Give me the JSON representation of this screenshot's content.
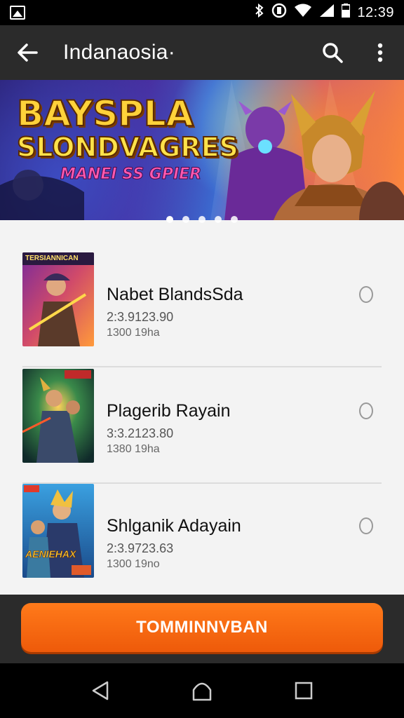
{
  "status_bar": {
    "time": "12:39",
    "icons": [
      "gallery-icon",
      "bluetooth-icon",
      "vibrate-icon",
      "wifi-icon",
      "signal-icon",
      "battery-icon"
    ]
  },
  "app_bar": {
    "title": "Indanaosia·",
    "icons": [
      "back-arrow-icon",
      "search-icon",
      "more-vert-icon"
    ]
  },
  "banner": {
    "line1": "BAYSPLA",
    "line2": "SLONDVAGRES",
    "line3": "MANEI SS GPIER",
    "dots_count": 5,
    "active_dot": 0
  },
  "games": [
    {
      "title": "Nabet BlandsSda",
      "subtitle": "2:3.9123.90",
      "meta": "1300 19ha",
      "thumb_caption": "TERSIANNICAN"
    },
    {
      "title": "Plagerib Rayain",
      "subtitle": "3:3.2123.80",
      "meta": "1380 19ha",
      "thumb_caption": ""
    },
    {
      "title": "Shlganik Adayain",
      "subtitle": "2:3.9723.63",
      "meta": "1300 19no",
      "thumb_caption": "AENIEHAX"
    }
  ],
  "action_button": {
    "label": "TOMMINNVBAN"
  },
  "nav_bar": {
    "icons": [
      "back-triangle-icon",
      "home-icon",
      "recents-icon"
    ]
  },
  "colors": {
    "accent": "#f26412",
    "app_bar": "#2b2b2b",
    "list_bg": "#f3f3f3"
  }
}
